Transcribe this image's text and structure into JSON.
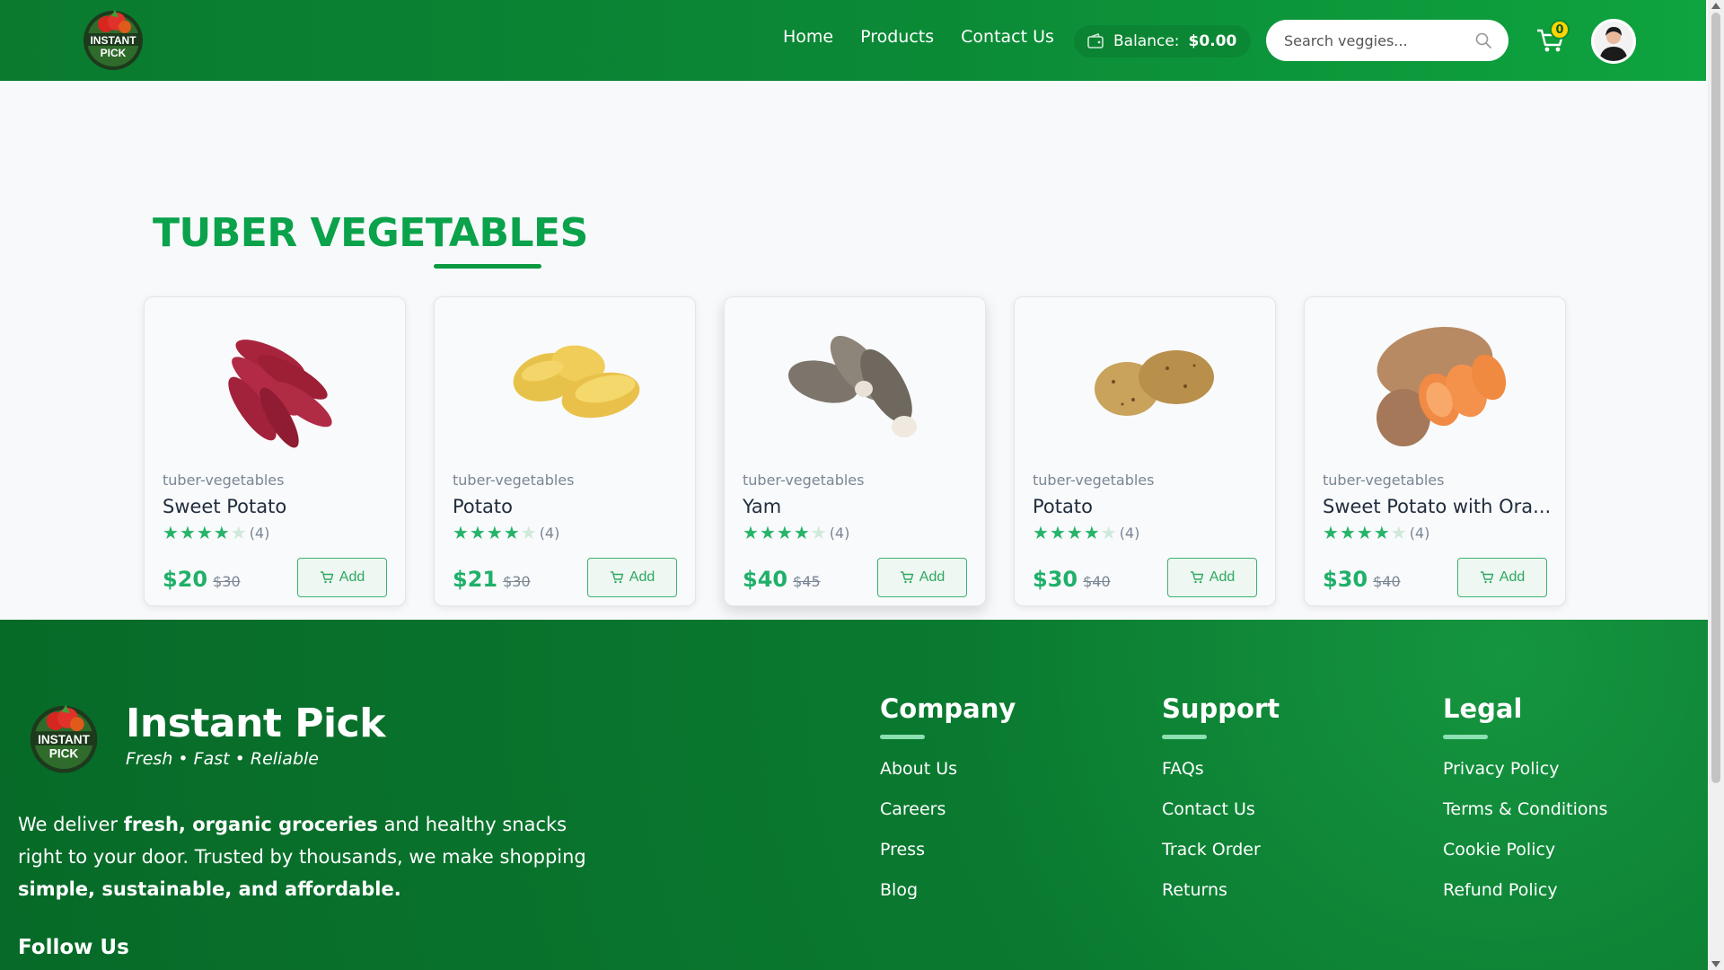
{
  "header": {
    "logo_text_line1": "INSTANT",
    "logo_text_line2": "PICK",
    "nav": [
      {
        "label": "Home"
      },
      {
        "label": "Products"
      },
      {
        "label": "Contact Us"
      }
    ],
    "balance_label": "Balance:",
    "balance_value": "$0.00",
    "search_placeholder": "Search veggies...",
    "cart_count": "0",
    "icons": {
      "balance": "wallet-icon",
      "search": "search-icon",
      "cart": "cart-icon",
      "avatar": "user-avatar"
    }
  },
  "section": {
    "title": "TUBER VEGETABLES"
  },
  "products": [
    {
      "category": "tuber-vegetables",
      "name": "Sweet Potato",
      "rating": 4,
      "rating_count": "(4)",
      "price": "$20",
      "old_price": "$30",
      "add_label": "Add",
      "image": "sweet-potato-image"
    },
    {
      "category": "tuber-vegetables",
      "name": "Potato",
      "rating": 4,
      "rating_count": "(4)",
      "price": "$21",
      "old_price": "$30",
      "add_label": "Add",
      "image": "yellow-potato-image"
    },
    {
      "category": "tuber-vegetables",
      "name": "Yam",
      "rating": 4,
      "rating_count": "(4)",
      "price": "$40",
      "old_price": "$45",
      "add_label": "Add",
      "image": "yam-image"
    },
    {
      "category": "tuber-vegetables",
      "name": "Potato",
      "rating": 4,
      "rating_count": "(4)",
      "price": "$30",
      "old_price": "$40",
      "add_label": "Add",
      "image": "russet-potato-image"
    },
    {
      "category": "tuber-vegetables",
      "name": "Sweet Potato with Ora...",
      "rating": 4,
      "rating_count": "(4)",
      "price": "$30",
      "old_price": "$40",
      "add_label": "Add",
      "image": "orange-sweet-potato-image"
    }
  ],
  "footer": {
    "brand": "Instant Pick",
    "tagline": "Fresh • Fast • Reliable",
    "desc_1": "We deliver ",
    "desc_b1": "fresh, organic groceries",
    "desc_2": " and healthy snacks right to your door. Trusted by thousands, we make shopping ",
    "desc_b2": "simple, sustainable, and affordable.",
    "follow": "Follow Us",
    "columns": [
      {
        "title": "Company",
        "links": [
          "About Us",
          "Careers",
          "Press",
          "Blog"
        ]
      },
      {
        "title": "Support",
        "links": [
          "FAQs",
          "Contact Us",
          "Track Order",
          "Returns"
        ]
      },
      {
        "title": "Legal",
        "links": [
          "Privacy Policy",
          "Terms & Conditions",
          "Cookie Policy",
          "Refund Policy"
        ]
      }
    ]
  },
  "colors": {
    "brand_green": "#0b8a36",
    "accent_green": "#0aa24a",
    "price_green": "#20b06a",
    "badge_yellow": "#ffd400"
  }
}
